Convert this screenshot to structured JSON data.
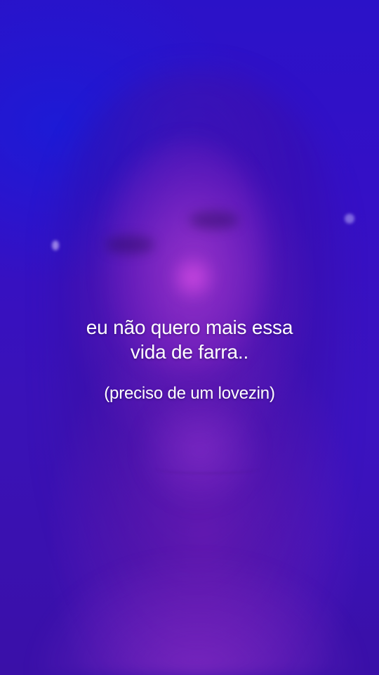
{
  "overlay": {
    "line1": "eu não quero mais essa",
    "line2": "vida de farra..",
    "subtitle": "(preciso de um lovezin)"
  },
  "colors": {
    "background_top": "#2b12c8",
    "background_bottom": "#3a10a8",
    "glow": "#b446dc",
    "text": "#ffffff"
  }
}
